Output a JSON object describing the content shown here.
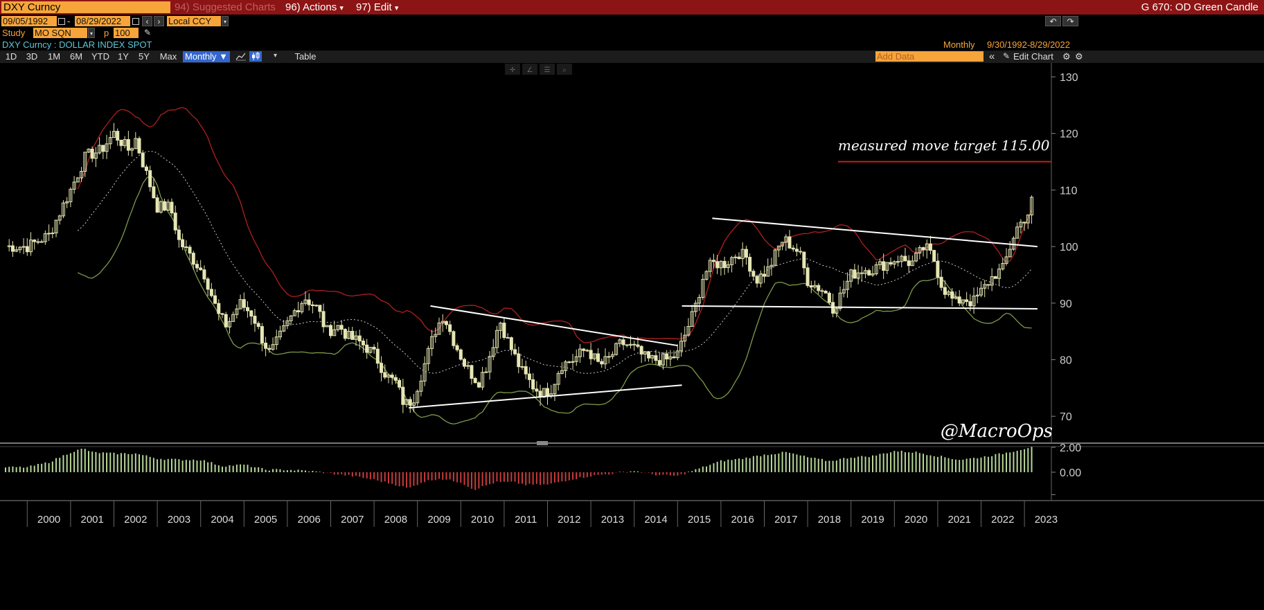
{
  "menubar": {
    "security": "DXY Curncy",
    "suggested": "94) Suggested Charts",
    "actions": "96) Actions",
    "actions_arrow": "▾",
    "edit": "97) Edit",
    "edit_arrow": "▾",
    "function_title": "G 670: OD Green Candle"
  },
  "controls": {
    "start_date": "09/05/1992",
    "date_sep": "-",
    "end_date": "08/29/2022",
    "currency": "Local CCY",
    "study_label": "Study",
    "study_value": "MO SQN",
    "p_label": "p",
    "p_value": "100",
    "undo": "↶",
    "redo": "↷"
  },
  "info": {
    "security_desc": "DXY Curncy : DOLLAR INDEX SPOT",
    "periodicity": "Monthly",
    "range": "9/30/1992-8/29/2022"
  },
  "toolbar": {
    "periods": [
      "1D",
      "3D",
      "1M",
      "6M",
      "YTD",
      "1Y",
      "5Y",
      "Max"
    ],
    "selected_period": "Monthly ▼",
    "table_label": "Table",
    "add_data_placeholder": "Add Data",
    "edit_chart": "Edit Chart",
    "collapse": "«"
  },
  "colors": {
    "menubar": "#8c1414",
    "orange_field": "#f7a53a",
    "selected_tab": "#3366cc",
    "candle": "#e6e6b4",
    "upper_band": "#b02020",
    "lower_band": "#7e9a4a",
    "middle_band": "#cccccc",
    "trendline": "#ffffff",
    "target_line": "#c81e1e",
    "positive_hist": "#b8d89a",
    "negative_hist": "#c83c3c"
  },
  "annotations": {
    "target_text": "measured move target 115.00",
    "watermark": "@MacroOps"
  },
  "chart_data": {
    "type": "candlestick",
    "title": "DXY Curncy : DOLLAR INDEX SPOT",
    "periodicity": "Monthly",
    "x_ticks": [
      "2000",
      "2001",
      "2002",
      "2003",
      "2004",
      "2005",
      "2006",
      "2007",
      "2008",
      "2009",
      "2010",
      "2011",
      "2012",
      "2013",
      "2014",
      "2015",
      "2016",
      "2017",
      "2018",
      "2019",
      "2020",
      "2021",
      "2022",
      "2023"
    ],
    "y_ticks": [
      70,
      80,
      90,
      100,
      110,
      120,
      130
    ],
    "ylim": [
      66,
      132
    ],
    "target_level": 115.0,
    "price_path": [
      [
        1999.5,
        100
      ],
      [
        2000.0,
        102
      ],
      [
        2000.5,
        110
      ],
      [
        2000.85,
        116
      ],
      [
        2001.2,
        117
      ],
      [
        2001.5,
        120
      ],
      [
        2001.85,
        117
      ],
      [
        2002.0,
        119
      ],
      [
        2002.2,
        114
      ],
      [
        2002.5,
        107
      ],
      [
        2002.8,
        107
      ],
      [
        2003.0,
        101
      ],
      [
        2003.3,
        98
      ],
      [
        2003.6,
        95
      ],
      [
        2003.9,
        88
      ],
      [
        2004.1,
        86
      ],
      [
        2004.4,
        90
      ],
      [
        2004.7,
        88
      ],
      [
        2004.9,
        84
      ],
      [
        2005.1,
        81
      ],
      [
        2005.4,
        85
      ],
      [
        2005.7,
        89
      ],
      [
        2005.9,
        91
      ],
      [
        2006.2,
        89
      ],
      [
        2006.4,
        85
      ],
      [
        2006.7,
        86
      ],
      [
        2006.9,
        84
      ],
      [
        2007.2,
        83
      ],
      [
        2007.5,
        81
      ],
      [
        2007.8,
        77
      ],
      [
        2008.0,
        76
      ],
      [
        2008.2,
        72
      ],
      [
        2008.4,
        73
      ],
      [
        2008.7,
        80
      ],
      [
        2008.9,
        85
      ],
      [
        2009.1,
        88
      ],
      [
        2009.3,
        84
      ],
      [
        2009.6,
        79
      ],
      [
        2009.9,
        76
      ],
      [
        2010.1,
        79
      ],
      [
        2010.4,
        87
      ],
      [
        2010.6,
        83
      ],
      [
        2010.9,
        78
      ],
      [
        2011.2,
        75
      ],
      [
        2011.4,
        74
      ],
      [
        2011.6,
        75
      ],
      [
        2011.8,
        79
      ],
      [
        2012.1,
        80
      ],
      [
        2012.4,
        82
      ],
      [
        2012.7,
        79
      ],
      [
        2012.9,
        80
      ],
      [
        2013.2,
        83
      ],
      [
        2013.5,
        82
      ],
      [
        2013.8,
        80
      ],
      [
        2014.0,
        80
      ],
      [
        2014.3,
        80
      ],
      [
        2014.5,
        81
      ],
      [
        2014.7,
        85
      ],
      [
        2014.9,
        89
      ],
      [
        2015.1,
        95
      ],
      [
        2015.3,
        97
      ],
      [
        2015.6,
        97
      ],
      [
        2015.9,
        99
      ],
      [
        2016.1,
        98
      ],
      [
        2016.3,
        94
      ],
      [
        2016.6,
        96
      ],
      [
        2016.9,
        101
      ],
      [
        2017.0,
        101
      ],
      [
        2017.3,
        99
      ],
      [
        2017.5,
        94
      ],
      [
        2017.7,
        93
      ],
      [
        2017.9,
        92
      ],
      [
        2018.1,
        89
      ],
      [
        2018.3,
        92
      ],
      [
        2018.5,
        95
      ],
      [
        2018.8,
        96
      ],
      [
        2019.0,
        96
      ],
      [
        2019.3,
        97
      ],
      [
        2019.6,
        98
      ],
      [
        2019.9,
        97
      ],
      [
        2020.2,
        100
      ],
      [
        2020.4,
        98
      ],
      [
        2020.6,
        93
      ],
      [
        2020.9,
        90
      ],
      [
        2021.1,
        91
      ],
      [
        2021.3,
        90
      ],
      [
        2021.5,
        92
      ],
      [
        2021.8,
        95
      ],
      [
        2022.0,
        96
      ],
      [
        2022.3,
        103
      ],
      [
        2022.6,
        106
      ],
      [
        2022.7,
        109
      ]
    ],
    "trendlines": [
      {
        "from": [
          2008.3,
          71.5
        ],
        "to": [
          2014.6,
          75.5
        ]
      },
      {
        "from": [
          2008.8,
          89.5
        ],
        "to": [
          2014.5,
          82.5
        ]
      },
      {
        "from": [
          2014.6,
          89.5
        ],
        "to": [
          2022.8,
          89.0
        ]
      },
      {
        "from": [
          2015.3,
          105.0
        ],
        "to": [
          2022.8,
          100.0
        ]
      }
    ],
    "histogram": {
      "y_ticks": [
        "2.00",
        "0.00"
      ],
      "values": [
        [
          1999.5,
          0.4
        ],
        [
          2000.0,
          0.8
        ],
        [
          2000.5,
          1.6
        ],
        [
          2000.8,
          1.9
        ],
        [
          2001.0,
          1.6
        ],
        [
          2001.5,
          1.5
        ],
        [
          2002.0,
          1.5
        ],
        [
          2002.5,
          1.1
        ],
        [
          2003.0,
          1.0
        ],
        [
          2003.5,
          1.0
        ],
        [
          2004.0,
          0.5
        ],
        [
          2004.5,
          0.6
        ],
        [
          2005.0,
          0.2
        ],
        [
          2005.5,
          0.2
        ],
        [
          2006.0,
          0.1
        ],
        [
          2006.5,
          -0.1
        ],
        [
          2007.0,
          -0.3
        ],
        [
          2007.5,
          -0.6
        ],
        [
          2008.0,
          -1.0
        ],
        [
          2008.3,
          -1.3
        ],
        [
          2008.6,
          -0.8
        ],
        [
          2009.0,
          -0.5
        ],
        [
          2009.5,
          -0.8
        ],
        [
          2009.8,
          -1.4
        ],
        [
          2010.3,
          -0.8
        ],
        [
          2010.7,
          -0.8
        ],
        [
          2011.0,
          -1.0
        ],
        [
          2011.5,
          -1.0
        ],
        [
          2012.0,
          -0.6
        ],
        [
          2012.5,
          -0.3
        ],
        [
          2013.0,
          -0.1
        ],
        [
          2013.5,
          0.1
        ],
        [
          2014.0,
          -0.2
        ],
        [
          2014.5,
          -0.3
        ],
        [
          2015.0,
          0.3
        ],
        [
          2015.5,
          0.9
        ],
        [
          2016.0,
          1.1
        ],
        [
          2016.5,
          1.4
        ],
        [
          2017.0,
          1.6
        ],
        [
          2017.5,
          1.2
        ],
        [
          2018.0,
          0.9
        ],
        [
          2018.5,
          1.2
        ],
        [
          2019.0,
          1.3
        ],
        [
          2019.5,
          1.7
        ],
        [
          2020.0,
          1.6
        ],
        [
          2020.5,
          1.3
        ],
        [
          2021.0,
          1.0
        ],
        [
          2021.5,
          1.2
        ],
        [
          2022.0,
          1.5
        ],
        [
          2022.5,
          1.9
        ],
        [
          2022.7,
          2.1
        ]
      ]
    }
  }
}
